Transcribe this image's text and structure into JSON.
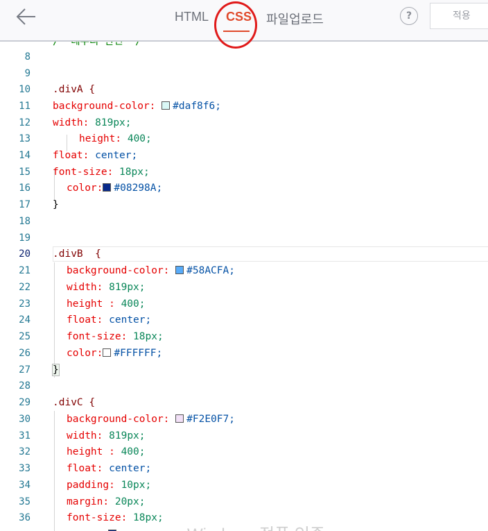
{
  "header": {
    "back_icon": "arrow-left-icon",
    "tabs": [
      {
        "label": "HTML"
      },
      {
        "label": "CSS"
      },
      {
        "label": "파일업로드"
      }
    ],
    "help_label": "?",
    "apply_label": "적용",
    "active_tab_color": "#e0492b",
    "annotation_color": "#e01a1a"
  },
  "editor": {
    "top_partial_line": "/* 테두리 관련 */",
    "lines": [
      {
        "n": "8"
      },
      {
        "n": "9"
      },
      {
        "n": "10"
      },
      {
        "n": "11"
      },
      {
        "n": "12"
      },
      {
        "n": "13"
      },
      {
        "n": "14"
      },
      {
        "n": "15"
      },
      {
        "n": "16"
      },
      {
        "n": "17"
      },
      {
        "n": "18"
      },
      {
        "n": "19"
      },
      {
        "n": "20"
      },
      {
        "n": "21"
      },
      {
        "n": "22"
      },
      {
        "n": "23"
      },
      {
        "n": "24"
      },
      {
        "n": "25"
      },
      {
        "n": "26"
      },
      {
        "n": "27"
      },
      {
        "n": "28"
      },
      {
        "n": "29"
      },
      {
        "n": "30"
      },
      {
        "n": "31"
      },
      {
        "n": "32"
      },
      {
        "n": "33"
      },
      {
        "n": "34"
      },
      {
        "n": "35"
      },
      {
        "n": "36"
      }
    ],
    "divA": {
      "selector": ".divA {",
      "bg_prop": "background-color:",
      "bg_val": "#daf8f6;",
      "width_prop": "width:",
      "width_val": "819px;",
      "height_prop": "height:",
      "height_val": "400;",
      "float_prop": "float:",
      "float_val": "center;",
      "fs_prop": "font-size:",
      "fs_val": "18px;",
      "color_prop": "color:",
      "color_val": "#08298A;",
      "close": "}"
    },
    "divB": {
      "selector": ".divB  {",
      "bg_prop": "background-color:",
      "bg_val": "#58ACFA;",
      "width_prop": "width:",
      "width_val": "819px;",
      "height_prop": "height :",
      "height_val": "400;",
      "float_prop": "float:",
      "float_val": "center;",
      "fs_prop": "font-size:",
      "fs_val": "18px;",
      "color_prop": "color:",
      "color_val": "#FFFFFF;",
      "close": "}"
    },
    "divC": {
      "selector": ".divC {",
      "bg_prop": "background-color:",
      "bg_val": "#F2E0F7;",
      "width_prop": "width:",
      "width_val": "819px;",
      "height_prop": "height :",
      "height_val": "400;",
      "float_prop": "float:",
      "float_val": "center;",
      "padding_prop": "padding:",
      "padding_val": "10px;",
      "margin_prop": "margin:",
      "margin_val": "20px;",
      "fs_prop": "font-size:",
      "fs_val": "18px;"
    },
    "swatches": {
      "daf8f6": "#daf8f6",
      "08298A": "#08298A",
      "58ACFA": "#58ACFA",
      "FFFFFF": "#FFFFFF",
      "F2E0F7": "#F2E0F7"
    }
  },
  "watermark": "Windows 정품 인증"
}
